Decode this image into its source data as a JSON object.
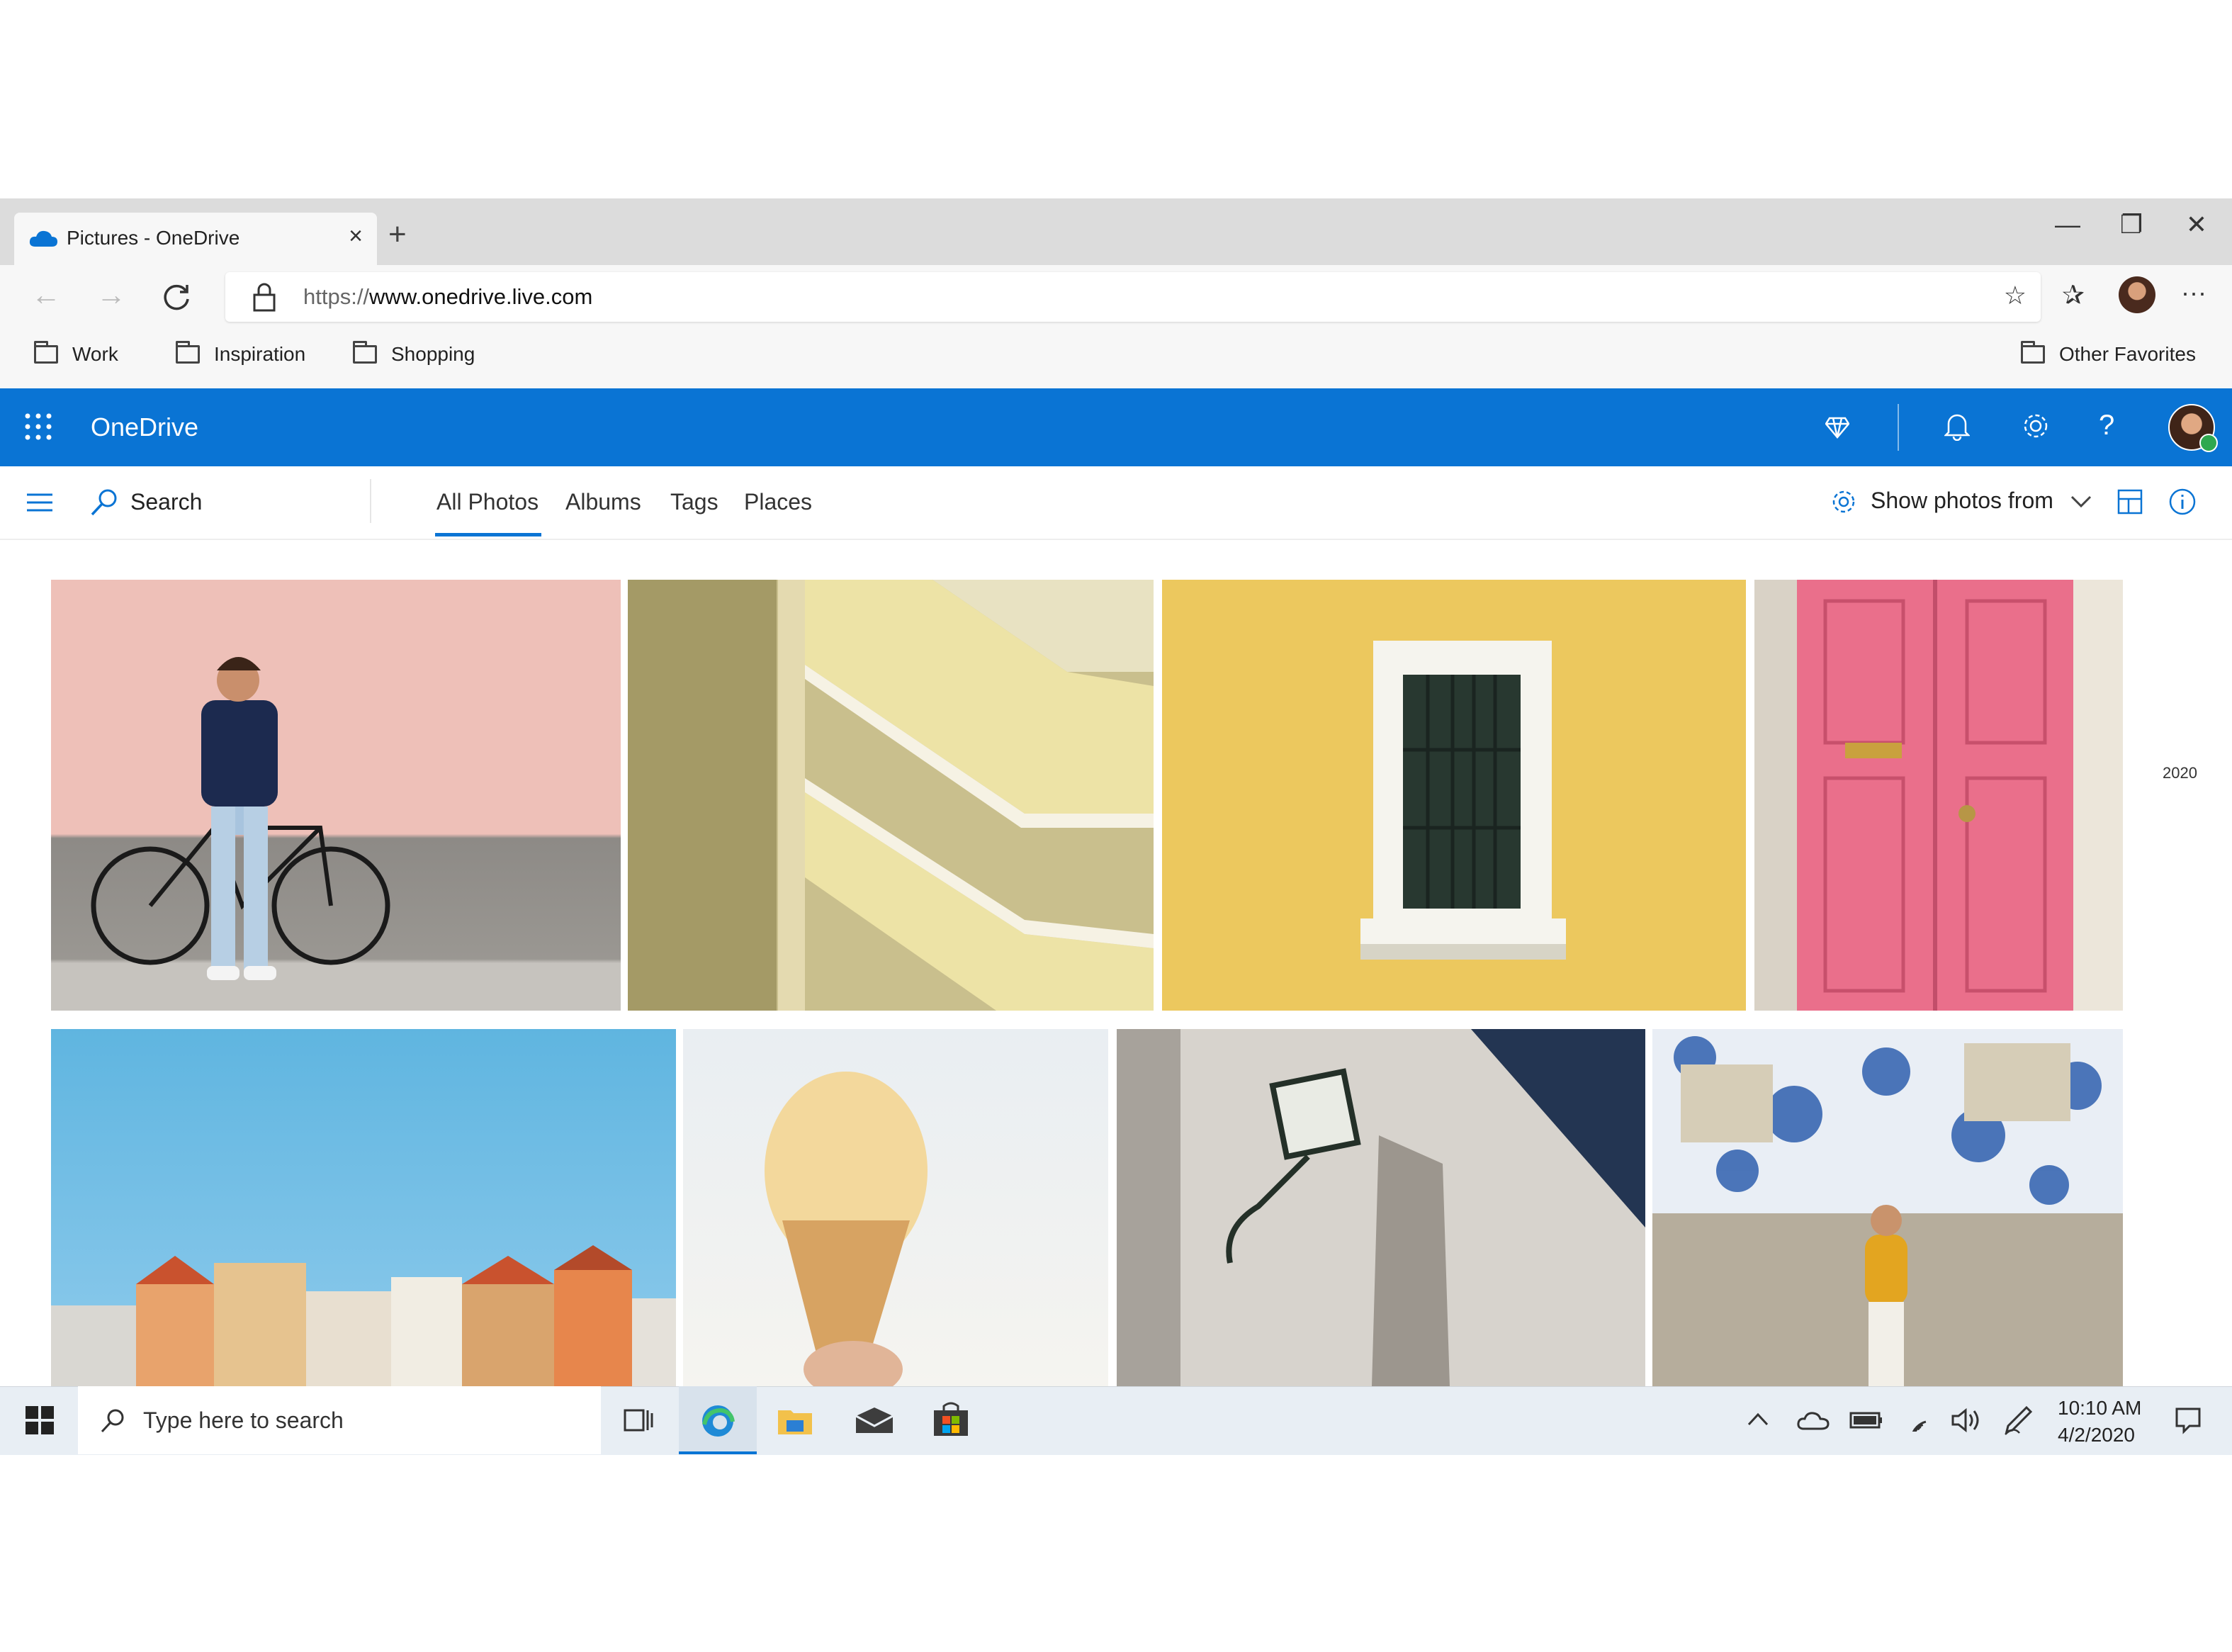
{
  "browser": {
    "tab_title": "Pictures - OneDrive",
    "close_tab": "×",
    "new_tab": "+",
    "window": {
      "minimize": "—",
      "restore": "❐",
      "close": "✕"
    },
    "url_scheme": "https://",
    "url_rest": "www.onedrive.live.com",
    "favorites": [
      "Work",
      "Inspiration",
      "Shopping"
    ],
    "other_favorites": "Other Favorites",
    "more": "···"
  },
  "onedrive": {
    "brand": "OneDrive",
    "search_label": "Search",
    "tabs": [
      "All Photos",
      "Albums",
      "Tags",
      "Places"
    ],
    "active_tab": "All Photos",
    "show_photos_from": "Show photos from",
    "year": "2020",
    "accent": "#0a74d4"
  },
  "taskbar": {
    "search_placeholder": "Type here to search",
    "time": "10:10 AM",
    "date": "4/2/2020"
  }
}
